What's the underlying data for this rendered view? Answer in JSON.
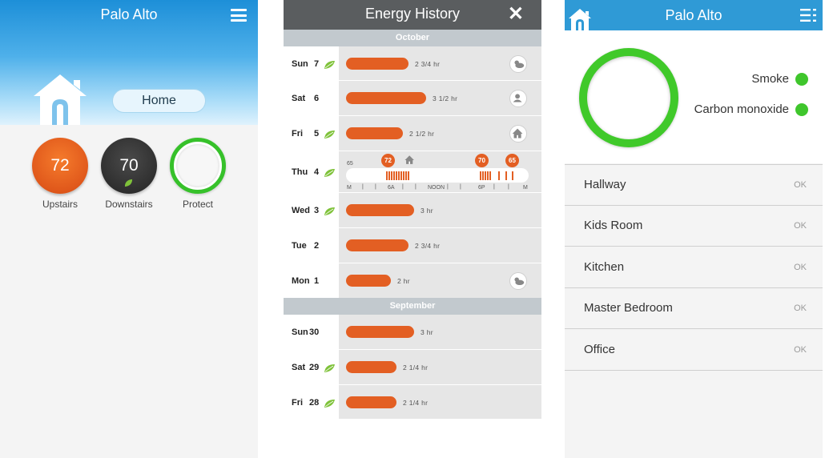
{
  "screen1": {
    "title": "Palo Alto",
    "home_button": "Home",
    "devices": [
      {
        "label": "Upstairs",
        "value": "72"
      },
      {
        "label": "Downstairs",
        "value": "70"
      },
      {
        "label": "Protect",
        "value": ""
      }
    ]
  },
  "screen2": {
    "title": "Energy History",
    "months": [
      "October",
      "September"
    ],
    "rows": [
      {
        "day": "Sun",
        "date": "7",
        "leaf": true,
        "duration": "2 3/4 hr",
        "usage_fraction": 0.46,
        "event_icon": "weather-icon"
      },
      {
        "day": "Sat",
        "date": "6",
        "leaf": false,
        "duration": "3 1/2 hr",
        "usage_fraction": 0.59,
        "event_icon": "person-icon"
      },
      {
        "day": "Fri",
        "date": "5",
        "leaf": true,
        "duration": "2 1/2 hr",
        "usage_fraction": 0.42,
        "event_icon": "away-icon"
      },
      {
        "day": "Thu",
        "date": "4",
        "leaf": true,
        "expanded": true
      },
      {
        "day": "Wed",
        "date": "3",
        "leaf": true,
        "duration": "3 hr",
        "usage_fraction": 0.5,
        "event_icon": ""
      },
      {
        "day": "Tue",
        "date": "2",
        "leaf": false,
        "duration": "2 3/4 hr",
        "usage_fraction": 0.46,
        "event_icon": ""
      },
      {
        "day": "Mon",
        "date": "1",
        "leaf": false,
        "duration": "2 hr",
        "usage_fraction": 0.33,
        "event_icon": "weather-icon"
      },
      {
        "day": "Sun",
        "date": "30",
        "leaf": false,
        "duration": "3 hr",
        "usage_fraction": 0.5,
        "event_icon": ""
      },
      {
        "day": "Sat",
        "date": "29",
        "leaf": true,
        "duration": "2 1/4 hr",
        "usage_fraction": 0.37,
        "event_icon": ""
      },
      {
        "day": "Fri",
        "date": "28",
        "leaf": true,
        "duration": "2 1/4 hr",
        "usage_fraction": 0.37,
        "event_icon": ""
      }
    ],
    "thursday_detail": {
      "start_temp": "65",
      "markers": [
        "72",
        "70",
        "65"
      ],
      "axis_labels": [
        "M",
        "6A",
        "NOON",
        "6P",
        "M"
      ]
    }
  },
  "screen3": {
    "title": "Palo Alto",
    "statuses": [
      {
        "label": "Smoke",
        "color": "#3fc62c"
      },
      {
        "label": "Carbon monoxide",
        "color": "#3fc62c"
      }
    ],
    "rooms": [
      {
        "name": "Hallway",
        "status": "OK"
      },
      {
        "name": "Kids Room",
        "status": "OK"
      },
      {
        "name": "Kitchen",
        "status": "OK"
      },
      {
        "name": "Master Bedroom",
        "status": "OK"
      },
      {
        "name": "Office",
        "status": "OK"
      }
    ]
  },
  "colors": {
    "accent_orange": "#e35f23",
    "leaf_green": "#7fc23a",
    "status_green": "#3fc62c",
    "header_blue": "#2f9ad6",
    "header_gray": "#5a5d5f"
  }
}
